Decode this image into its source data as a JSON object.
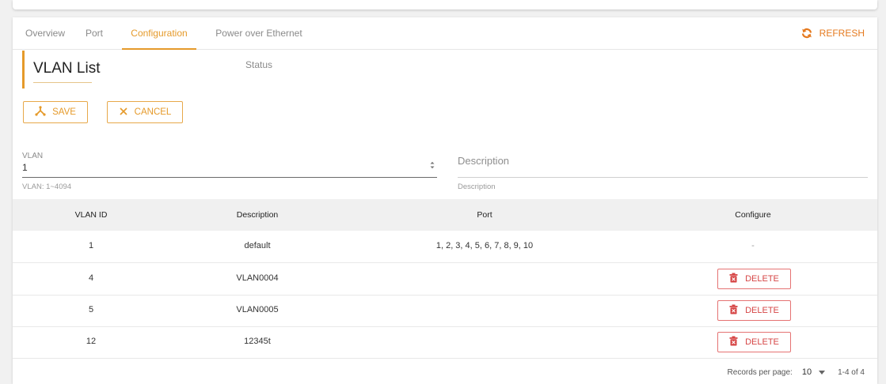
{
  "tabs": [
    {
      "label": "Overview",
      "active": false
    },
    {
      "label": "Port",
      "active": false
    },
    {
      "label": "Configuration",
      "active": true
    },
    {
      "label": "Power over Ethernet Status",
      "active": false
    }
  ],
  "refresh": {
    "label": "REFRESH",
    "icon": "refresh-icon"
  },
  "page": {
    "title": "VLAN List"
  },
  "actions": {
    "save": {
      "label": "SAVE",
      "icon": "save-icon"
    },
    "cancel": {
      "label": "CANCEL",
      "icon": "close-icon"
    }
  },
  "form": {
    "vlan": {
      "label": "VLAN",
      "value": "1",
      "hint": "VLAN: 1~4094"
    },
    "description": {
      "placeholder": "Description",
      "hint": "Description"
    }
  },
  "table": {
    "headers": {
      "vlan_id": "VLAN ID",
      "description": "Description",
      "port": "Port",
      "configure": "Configure"
    },
    "rows": [
      {
        "vlan_id": "1",
        "description": "default",
        "port": "1, 2, 3, 4, 5, 6, 7, 8, 9, 10",
        "configure": "-"
      },
      {
        "vlan_id": "4",
        "description": "VLAN0004",
        "port": "",
        "configure": "DELETE"
      },
      {
        "vlan_id": "5",
        "description": "VLAN0005",
        "port": "",
        "configure": "DELETE"
      },
      {
        "vlan_id": "12",
        "description": "12345t",
        "port": "",
        "configure": "DELETE"
      }
    ]
  },
  "pagination": {
    "records_label": "Records per page:",
    "per_page": "10",
    "range": "1-4 of 4"
  },
  "colors": {
    "accent": "#e59a2a",
    "danger": "#d64545",
    "refresh": "#e57a1f"
  }
}
